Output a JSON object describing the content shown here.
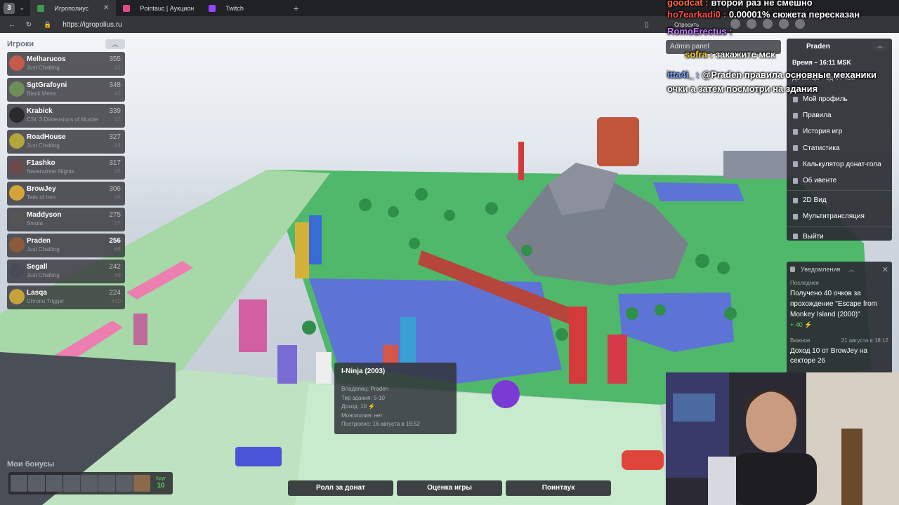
{
  "browser": {
    "tabs": [
      {
        "title": "Игрополиус",
        "color": "#3c9a4f"
      },
      {
        "title": "Pointauc | Аукцион для стримеров",
        "color": "#e04a8a"
      },
      {
        "title": "Twitch",
        "color": "#9146ff"
      }
    ],
    "url": "https://igropolius.ru",
    "ask_label": "Спросить"
  },
  "players_panel": {
    "title": "Игроки",
    "players": [
      {
        "name": "Melharucos",
        "game": "Just Chatting",
        "score": "355",
        "rank": "#1",
        "color": "#c45a4a"
      },
      {
        "name": "SgtGrafoyni",
        "game": "Black Mesa",
        "score": "348",
        "rank": "#2",
        "color": "#6b8e5a"
      },
      {
        "name": "Krabick",
        "game": "CSI: 3 Dimensions of Murder",
        "score": "339",
        "rank": "#3",
        "color": "#2a2a2a"
      },
      {
        "name": "RoadHouse",
        "game": "Just Chatting",
        "score": "327",
        "rank": "#4",
        "color": "#b3a63a"
      },
      {
        "name": "F1ashko",
        "game": "Neverwinter Nights",
        "score": "317",
        "rank": "#5",
        "color": "#6a4a4a"
      },
      {
        "name": "BrowJey",
        "game": "Tails of Iron",
        "score": "306",
        "rank": "#6",
        "color": "#d4a43a"
      },
      {
        "name": "Maddyson",
        "game": "Smuta",
        "score": "275",
        "rank": "#7",
        "color": "#555555"
      },
      {
        "name": "Praden",
        "game": "Just Chatting",
        "score": "256",
        "rank": "#8",
        "color": "#8a5a3a"
      },
      {
        "name": "Segall",
        "game": "Just Chatting",
        "score": "242",
        "rank": "#9",
        "color": "#4a4a5a"
      },
      {
        "name": "Lasqa",
        "game": "Chrono Trigger",
        "score": "224",
        "rank": "#10",
        "color": "#c4a43a"
      }
    ]
  },
  "bonuses": {
    "title": "Мои бонусы",
    "lap_label": "Круг",
    "lap_value": "10"
  },
  "tooltip": {
    "title": "I-Ninja (2003)",
    "owner": "Владелец: Praden",
    "tier": "Тир здания: 5-10",
    "income": "Доход: 10 ⚡",
    "monopoly": "Монополия: нет",
    "built": "Построено: 16 августа в 16:52"
  },
  "actions": {
    "roll": "Ролл за донат",
    "rate": "Оценка игры",
    "pointauc": "Поинтаук"
  },
  "admin_panel": {
    "label": "Admin panel"
  },
  "user_menu": {
    "username": "Praden",
    "time": "Время – 16:11 MSK",
    "ends": "До конца – 9д 4ч 48м",
    "items": [
      "Мой профиль",
      "Правила",
      "История игр",
      "Статистика",
      "Калькулятор донат-гола",
      "Об ивенте"
    ],
    "items2": [
      "2D Вид",
      "Мультитрансляция"
    ],
    "logout": "Выйти"
  },
  "notifications": {
    "title": "Уведомления",
    "latest_label": "Последнее",
    "latest_msg": "Получено 40 очков за прохождение \"Escape from Monkey Island (2000)\"",
    "latest_pts": "+ 40 ⚡",
    "important_label": "Важное",
    "important_date": "21 августа в 18:12",
    "important_msg": "Доход 10 от BrowJey на секторе 26"
  },
  "chat": [
    {
      "user": "goodcat :",
      "text": "второй раз не смешно",
      "color": "#ff6a3d"
    },
    {
      "user": "ho7earkadi0 :",
      "text": "0.00001% сюжета пересказан",
      "color": "#ff4d4d"
    },
    {
      "user": "RomoErectus :",
      "text": "",
      "color": "#c77dff"
    },
    {
      "user": "sofra :",
      "text": "закажите мск",
      "color": "#ffd23f"
    },
    {
      "user": "itta4i_ :",
      "text": "@Praden правила основные механики",
      "color": "#7aa2ff"
    },
    {
      "user": "",
      "text": "очки а затем посмотри на здания",
      "color": "#ffffff"
    }
  ],
  "colors": {
    "board_green": "#a6d8a8",
    "water": "#5d74d6",
    "rock": "#7a7f8c",
    "accent_green": "#5fd35f"
  }
}
